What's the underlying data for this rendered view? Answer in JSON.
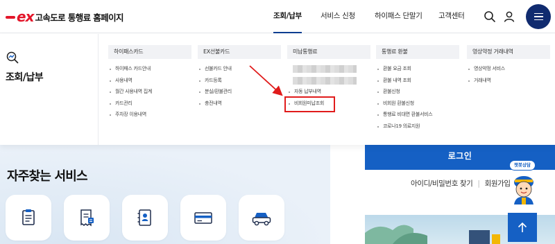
{
  "brand": {
    "logo_mark": "ex",
    "site_name": "고속도로 통행료 홈페이지",
    "primary_color": "#102b6f",
    "accent_blue": "#1560c4",
    "logo_red": "#e3162a"
  },
  "gnb": {
    "items": [
      {
        "label": "조회/납부",
        "active": true
      },
      {
        "label": "서비스 신청",
        "active": false
      },
      {
        "label": "하이패스 단말기",
        "active": false
      },
      {
        "label": "고객센터",
        "active": false
      }
    ],
    "icons": [
      "search-icon",
      "user-icon",
      "hamburger-menu-icon"
    ]
  },
  "mega_menu": {
    "section_title": "조회/납부",
    "section_icon": "search-chart-icon",
    "columns": [
      {
        "heading": "하이패스카드",
        "items": [
          "하이패스 카드안내",
          "사용내역",
          "월간 사용내역 집계",
          "카드관리",
          "주차장 이용내역"
        ]
      },
      {
        "heading": "EX선불카드",
        "items": [
          "선불카드 안내",
          "카드등록",
          "분실/환불관리",
          "충전내역"
        ]
      },
      {
        "heading": "미납통행료",
        "items": [
          "",
          "",
          "자동 납부내역",
          "비회원미납조회"
        ],
        "highlighted_item": "비회원미납조회"
      },
      {
        "heading": "통행료 환불",
        "items": [
          "환불 요금 조회",
          "환불 내역 조회",
          "환불신청",
          "비회원 환불신청",
          "통행료 비대면 환불서비스",
          "코로나19 의료지원"
        ]
      },
      {
        "heading": "영상약정 거래내역",
        "items": [
          "영상약정 서비스",
          "거래내역"
        ]
      }
    ]
  },
  "main": {
    "faq_title": "자주찾는 서비스",
    "faq_tiles": [
      "clipboard-list-icon",
      "receipt-icon",
      "contact-card-icon",
      "credit-card-icon",
      "car-icon"
    ]
  },
  "side_panel": {
    "login_label": "로그인",
    "find_account_label": "아이디/비밀번호 찾기",
    "join_label": "회원가입",
    "chatbot_label": "챗봇상담",
    "banner_text": "모집"
  }
}
